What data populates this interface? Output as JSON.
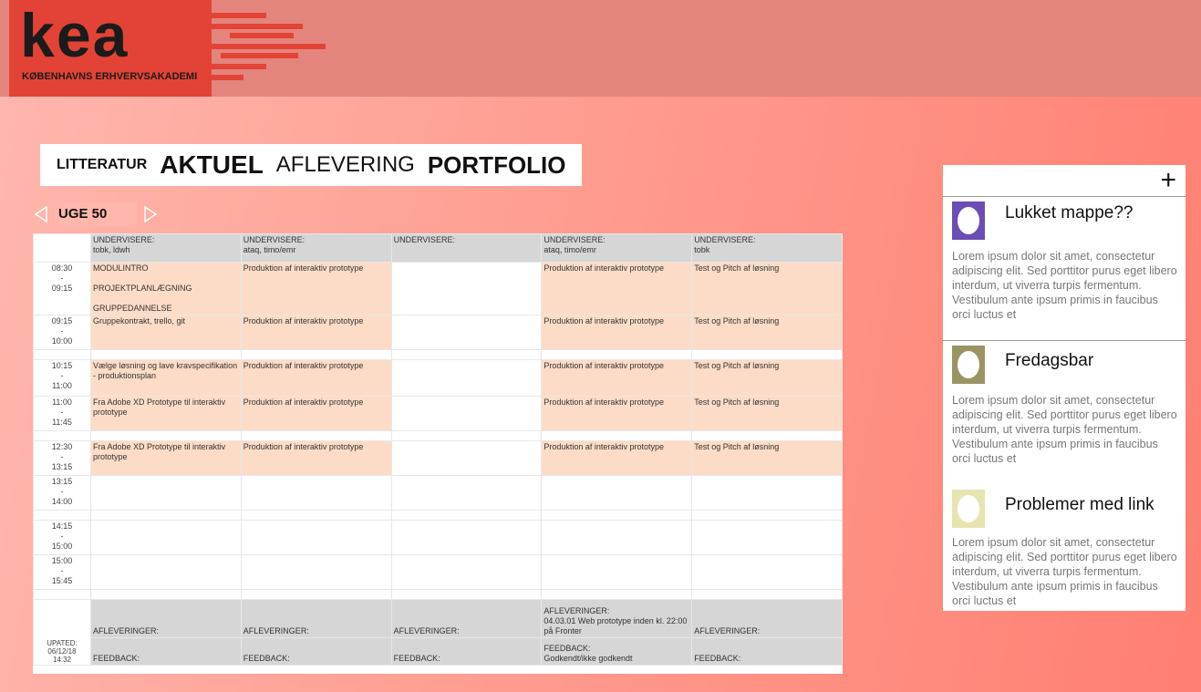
{
  "logo": {
    "word": "kea",
    "sub": "KØBENHAVNS ERHVERVSAKADEMI"
  },
  "nav": [
    "LITTERATUR",
    "AKTUEL",
    "AFLEVERING",
    "PORTFOLIO"
  ],
  "week": {
    "label": "UGE 50"
  },
  "schedule": {
    "header": [
      "UNDERVISERE:\ntobk, ldwh",
      "UNDERVISERE:\nataq, timo/emr",
      "UNDERVISERE:",
      "UNDERVISERE:\nataq, timo/emr",
      "UNDERVISERE:\ntobk"
    ],
    "times": [
      "08:30\n-\n09:15",
      "09:15\n-\n10:00",
      "10:15\n-\n11:00",
      "11:00\n-\n11:45",
      "12:30\n-\n13:15",
      "13:15\n-\n14:00",
      "14:15\n-\n15:00",
      "15:00\n-\n15:45"
    ],
    "rows": [
      [
        "MODULINTRO\n\nPROJEKTPLANLÆGNING\n\nGRUPPEDANNELSE",
        "Produktion af interaktiv prototype",
        "",
        "Produktion af interaktiv prototype",
        "Test og Pitch af løsning"
      ],
      [
        "Gruppekontrakt, trello, git",
        "Produktion af interaktiv prototype",
        "",
        "Produktion af interaktiv prototype",
        "Test og Pitch af løsning"
      ],
      [
        "Vælge løsning og lave kravspecifikation - produktionsplan",
        "Produktion af interaktiv prototype",
        "",
        "Produktion af interaktiv prototype",
        "Test og Pitch af løsning"
      ],
      [
        "Fra Adobe XD Prototype til interaktiv prototype",
        "Produktion af interaktiv prototype",
        "",
        "Produktion af interaktiv prototype",
        "Test og Pitch af løsning"
      ],
      [
        "Fra Adobe XD Prototype til interaktiv prototype",
        "Produktion af interaktiv prototype",
        "",
        "Produktion af interaktiv prototype",
        "Test og Pitch af løsning"
      ],
      [
        "",
        "",
        "",
        "",
        ""
      ],
      [
        "",
        "",
        "",
        "",
        ""
      ],
      [
        "",
        "",
        "",
        "",
        ""
      ]
    ],
    "updated": "UPATED:\n06/12/18\n14:32",
    "afleveringer": [
      "AFLEVERINGER:",
      "AFLEVERINGER:",
      "AFLEVERINGER:",
      "AFLEVERINGER:\n04.03.01 Web prototype inden kl. 22:00 på Fronter",
      "AFLEVERINGER:"
    ],
    "feedback": [
      "FEEDBACK:",
      "FEEDBACK:",
      "FEEDBACK:",
      "FEEDBACK:\nGodkendt/ikke godkendt",
      "FEEDBACK:"
    ]
  },
  "sidebar": {
    "plus": "+",
    "cards": [
      {
        "title": "Lukket mappe??",
        "color": "#6b4db5",
        "body": "Lorem ipsum dolor sit amet, consectetur adipiscing elit. Sed porttitor purus eget libero interdum, ut viverra turpis fermentum. Vestibulum ante ipsum primis in faucibus orci luctus et"
      },
      {
        "title": "Fredagsbar",
        "color": "#9a9462",
        "body": "Lorem ipsum dolor sit amet, consectetur adipiscing elit. Sed porttitor purus eget libero interdum, ut viverra turpis fermentum. Vestibulum ante ipsum primis in faucibus orci luctus et"
      },
      {
        "title": "Problemer med link",
        "color": "#e8e4b0",
        "body": "Lorem ipsum dolor sit amet, consectetur adipiscing elit. Sed porttitor purus eget libero interdum, ut viverra turpis fermentum. Vestibulum ante ipsum primis in faucibus orci luctus et"
      }
    ]
  },
  "colors": {
    "accent": "#e34336",
    "topbar": "#e3857d",
    "cell": "#fcdcc6",
    "header": "#d6d6d6"
  }
}
